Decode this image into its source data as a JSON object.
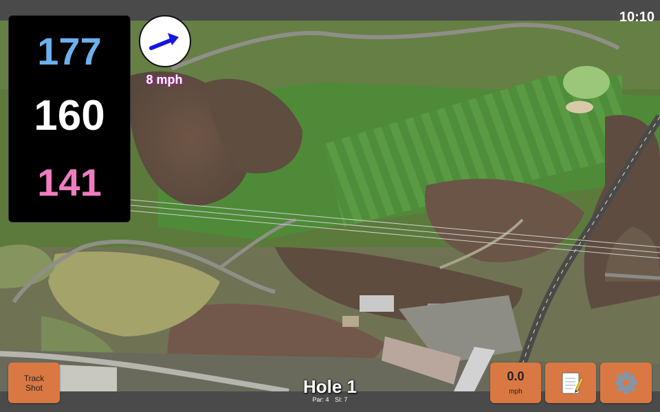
{
  "status_bar": {
    "time": "10:10"
  },
  "distances": {
    "back": "177",
    "middle": "160",
    "front": "141"
  },
  "wind": {
    "speed": "8 mph",
    "icon": "wind-arrow-icon",
    "arrow_color": "#1515e0"
  },
  "track_shot": {
    "line1": "Track",
    "line2": "Shot"
  },
  "speed_button": {
    "value": "0.0",
    "unit": "mph"
  },
  "notes_button": {
    "icon": "notepad-icon"
  },
  "settings_button": {
    "icon": "gear-icon"
  },
  "hole": {
    "title": "Hole 1",
    "par": "Par: 4",
    "si": "SI: 7"
  },
  "colors": {
    "back_distance": "#6ab1ee",
    "middle_distance": "#ffffff",
    "front_distance": "#f07cc0",
    "button": "#d97842",
    "bar": "#4a4a4a"
  }
}
